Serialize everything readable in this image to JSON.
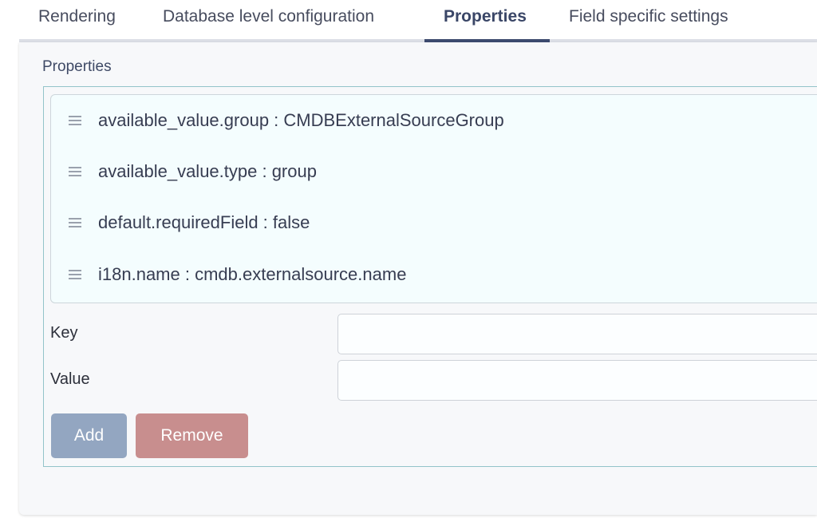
{
  "tabs": [
    {
      "label": "Rendering"
    },
    {
      "label": "Database level configuration"
    },
    {
      "label": "Properties"
    },
    {
      "label": "Field specific settings"
    }
  ],
  "active_tab": "Properties",
  "section": {
    "title": "Properties"
  },
  "properties": [
    {
      "text": "available_value.group : CMDBExternalSourceGroup"
    },
    {
      "text": "available_value.type : group"
    },
    {
      "text": "default.requiredField : false"
    },
    {
      "text": "i18n.name : cmdb.externalsource.name"
    }
  ],
  "form": {
    "key_label": "Key",
    "key_value": "",
    "value_label": "Value",
    "value_value": ""
  },
  "buttons": {
    "add": "Add",
    "remove": "Remove"
  },
  "icons": {
    "drag_handle": "drag-handle-icon"
  },
  "colors": {
    "active_tab": "#3d4b6f",
    "fieldset_border": "#93c4c9",
    "add_button": "#93a6c1",
    "remove_button": "#c88e8e",
    "list_background": "#f4fdfe"
  }
}
